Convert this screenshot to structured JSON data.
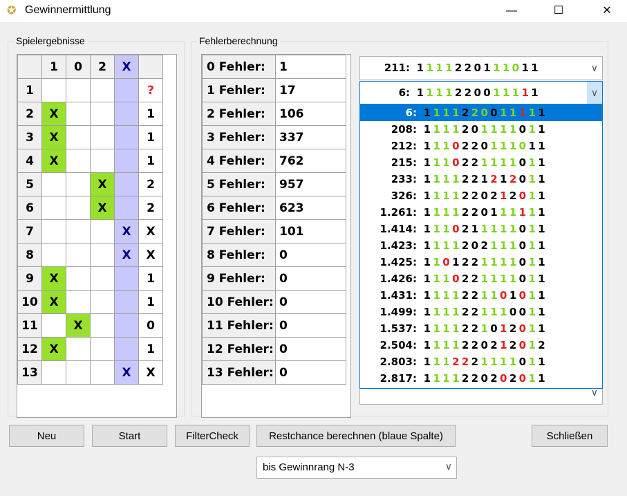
{
  "window": {
    "title": "Gewinnermittlung",
    "minimize": "—",
    "maximize": "☐",
    "close": "✕"
  },
  "left_group": {
    "label": "Spielergebnisse"
  },
  "mid_group": {
    "label": "Fehlerberechnung"
  },
  "results": {
    "headers": [
      "1",
      "0",
      "2",
      "X",
      ""
    ],
    "rows": [
      {
        "n": "1",
        "c1": "",
        "c0": "",
        "c2": "",
        "cx": "",
        "res": "?"
      },
      {
        "n": "2",
        "c1": "X",
        "c0": "",
        "c2": "",
        "cx": "",
        "res": "1"
      },
      {
        "n": "3",
        "c1": "X",
        "c0": "",
        "c2": "",
        "cx": "",
        "res": "1"
      },
      {
        "n": "4",
        "c1": "X",
        "c0": "",
        "c2": "",
        "cx": "",
        "res": "1"
      },
      {
        "n": "5",
        "c1": "",
        "c0": "",
        "c2": "X",
        "cx": "",
        "res": "2"
      },
      {
        "n": "6",
        "c1": "",
        "c0": "",
        "c2": "X",
        "cx": "",
        "res": "2"
      },
      {
        "n": "7",
        "c1": "",
        "c0": "",
        "c2": "",
        "cx": "X",
        "res": "X"
      },
      {
        "n": "8",
        "c1": "",
        "c0": "",
        "c2": "",
        "cx": "X",
        "res": "X"
      },
      {
        "n": "9",
        "c1": "X",
        "c0": "",
        "c2": "",
        "cx": "",
        "res": "1"
      },
      {
        "n": "10",
        "c1": "X",
        "c0": "",
        "c2": "",
        "cx": "",
        "res": "1"
      },
      {
        "n": "11",
        "c1": "",
        "c0": "X",
        "c2": "",
        "cx": "",
        "res": "0"
      },
      {
        "n": "12",
        "c1": "X",
        "c0": "",
        "c2": "",
        "cx": "",
        "res": "1"
      },
      {
        "n": "13",
        "c1": "",
        "c0": "",
        "c2": "",
        "cx": "X",
        "res": "X"
      }
    ]
  },
  "errors": [
    {
      "label": "0 Fehler:",
      "value": "1"
    },
    {
      "label": "1 Fehler:",
      "value": "17"
    },
    {
      "label": "2 Fehler:",
      "value": "106"
    },
    {
      "label": "3 Fehler:",
      "value": "337"
    },
    {
      "label": "4 Fehler:",
      "value": "762"
    },
    {
      "label": "5 Fehler:",
      "value": "957"
    },
    {
      "label": "6 Fehler:",
      "value": "623"
    },
    {
      "label": "7 Fehler:",
      "value": "101"
    },
    {
      "label": "8 Fehler:",
      "value": "0"
    },
    {
      "label": "9 Fehler:",
      "value": "0"
    },
    {
      "label": "10 Fehler:",
      "value": "0"
    },
    {
      "label": "11 Fehler:",
      "value": "0"
    },
    {
      "label": "12 Fehler:",
      "value": "0"
    },
    {
      "label": "13 Fehler:",
      "value": "0"
    }
  ],
  "combo1": {
    "num": "211:",
    "digits": "1111220111011",
    "colors": "kgggkkkkgggkk"
  },
  "combo2": {
    "num": "6:",
    "digits": "1111220011111",
    "colors": "kgggkkkkgggrkk"
  },
  "dropdown": [
    {
      "num": "6:",
      "digits": "1111220011111",
      "colors": "kgggkggkggrgk",
      "selected": true
    },
    {
      "num": "208:",
      "digits": "1111201111011",
      "colors": "kgggkkggggkgk"
    },
    {
      "num": "212:",
      "digits": "1110220111011",
      "colors": "kggrkkkggggkk"
    },
    {
      "num": "215:",
      "digits": "1110221111011",
      "colors": "kggrkkggggkgk"
    },
    {
      "num": "233:",
      "digits": "1111221212011",
      "colors": "kgggkkkrkrkgk"
    },
    {
      "num": "326:",
      "digits": "1111220212011",
      "colors": "kgggkkkkrkrgk"
    },
    {
      "num": "1.261:",
      "digits": "1111220111111",
      "colors": "kgggkkkkggrgk"
    },
    {
      "num": "1.414:",
      "digits": "1110211111011",
      "colors": "kggrkkggggkgk"
    },
    {
      "num": "1.423:",
      "digits": "1111202111011",
      "colors": "kgggkkkgggkgk"
    },
    {
      "num": "1.425:",
      "digits": "1101221111011",
      "colors": "kgrkkkggggkgk"
    },
    {
      "num": "1.426:",
      "digits": "1110221111011",
      "colors": "kggrkkggggkgk"
    },
    {
      "num": "1.431:",
      "digits": "1111221101011",
      "colors": "kgggkkggrkrgk"
    },
    {
      "num": "1.499:",
      "digits": "1111221110011",
      "colors": "kgggkkgggkkgk"
    },
    {
      "num": "1.537:",
      "digits": "1111221012011",
      "colors": "kgggkkgkrkrgk"
    },
    {
      "num": "2.504:",
      "digits": "1111220212012",
      "colors": "kgggkkkkrkrgk"
    },
    {
      "num": "2.803:",
      "digits": "1112221111011",
      "colors": "kggrrkggggkgk"
    },
    {
      "num": "2.817:",
      "digits": "1111220202011",
      "colors": "kgggkkkkrkrgk"
    }
  ],
  "buttons": {
    "neu": "Neu",
    "start": "Start",
    "filter": "FilterCheck",
    "restchance": "Restchance berechnen (blaue Spalte)",
    "close": "Schließen"
  },
  "rank_select": {
    "value": "bis Gewinnrang N-3"
  },
  "icons": {
    "app": "star-icon",
    "arrow": "chevron-down-icon"
  }
}
